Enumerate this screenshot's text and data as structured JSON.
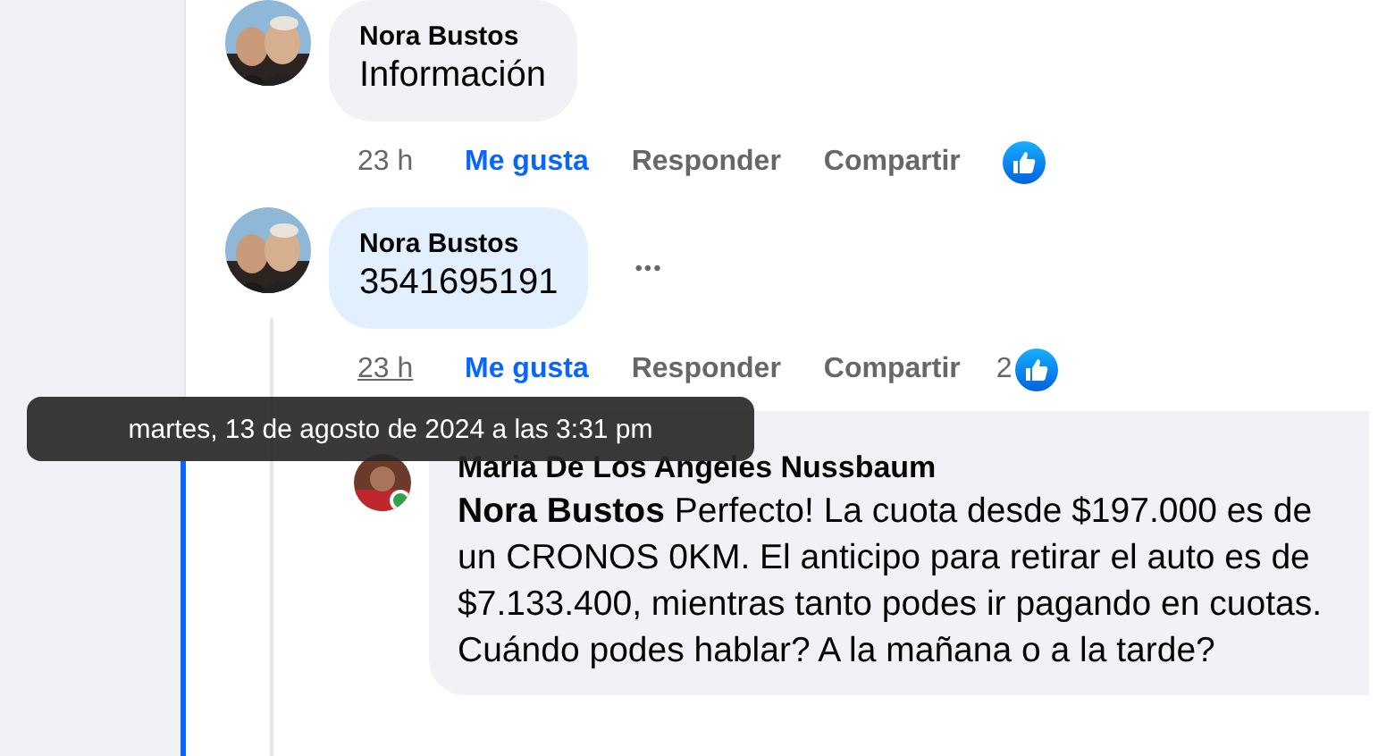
{
  "comments": [
    {
      "author": "Nora Bustos",
      "text": "Información",
      "highlighted": false,
      "time": "23 h",
      "time_underlined": false,
      "actions": [
        "Me gusta",
        "Responder",
        "Compartir"
      ]
    },
    {
      "author": "Nora Bustos",
      "text": "3541695191",
      "highlighted": true,
      "more_label": "•••",
      "time": "23 h",
      "time_underlined": true,
      "actions": [
        "Me gusta",
        "Responder",
        "Compartir"
      ],
      "like_count": "2"
    }
  ],
  "reply": {
    "author": "Maria De Los Angeles Nussbaum",
    "mention": "Nora Bustos",
    "text": "Perfecto! La cuota desde $197.000 es de un CRONOS 0KM. El anticipo para retirar el auto es de $7.133.400, mientras tanto podes ir pagando en cuotas. Cuándo podes hablar? A la mañana o a la tarde?",
    "online": true
  },
  "tooltip": {
    "text": "martes, 13 de agosto de 2024 a las 3:31 pm"
  }
}
